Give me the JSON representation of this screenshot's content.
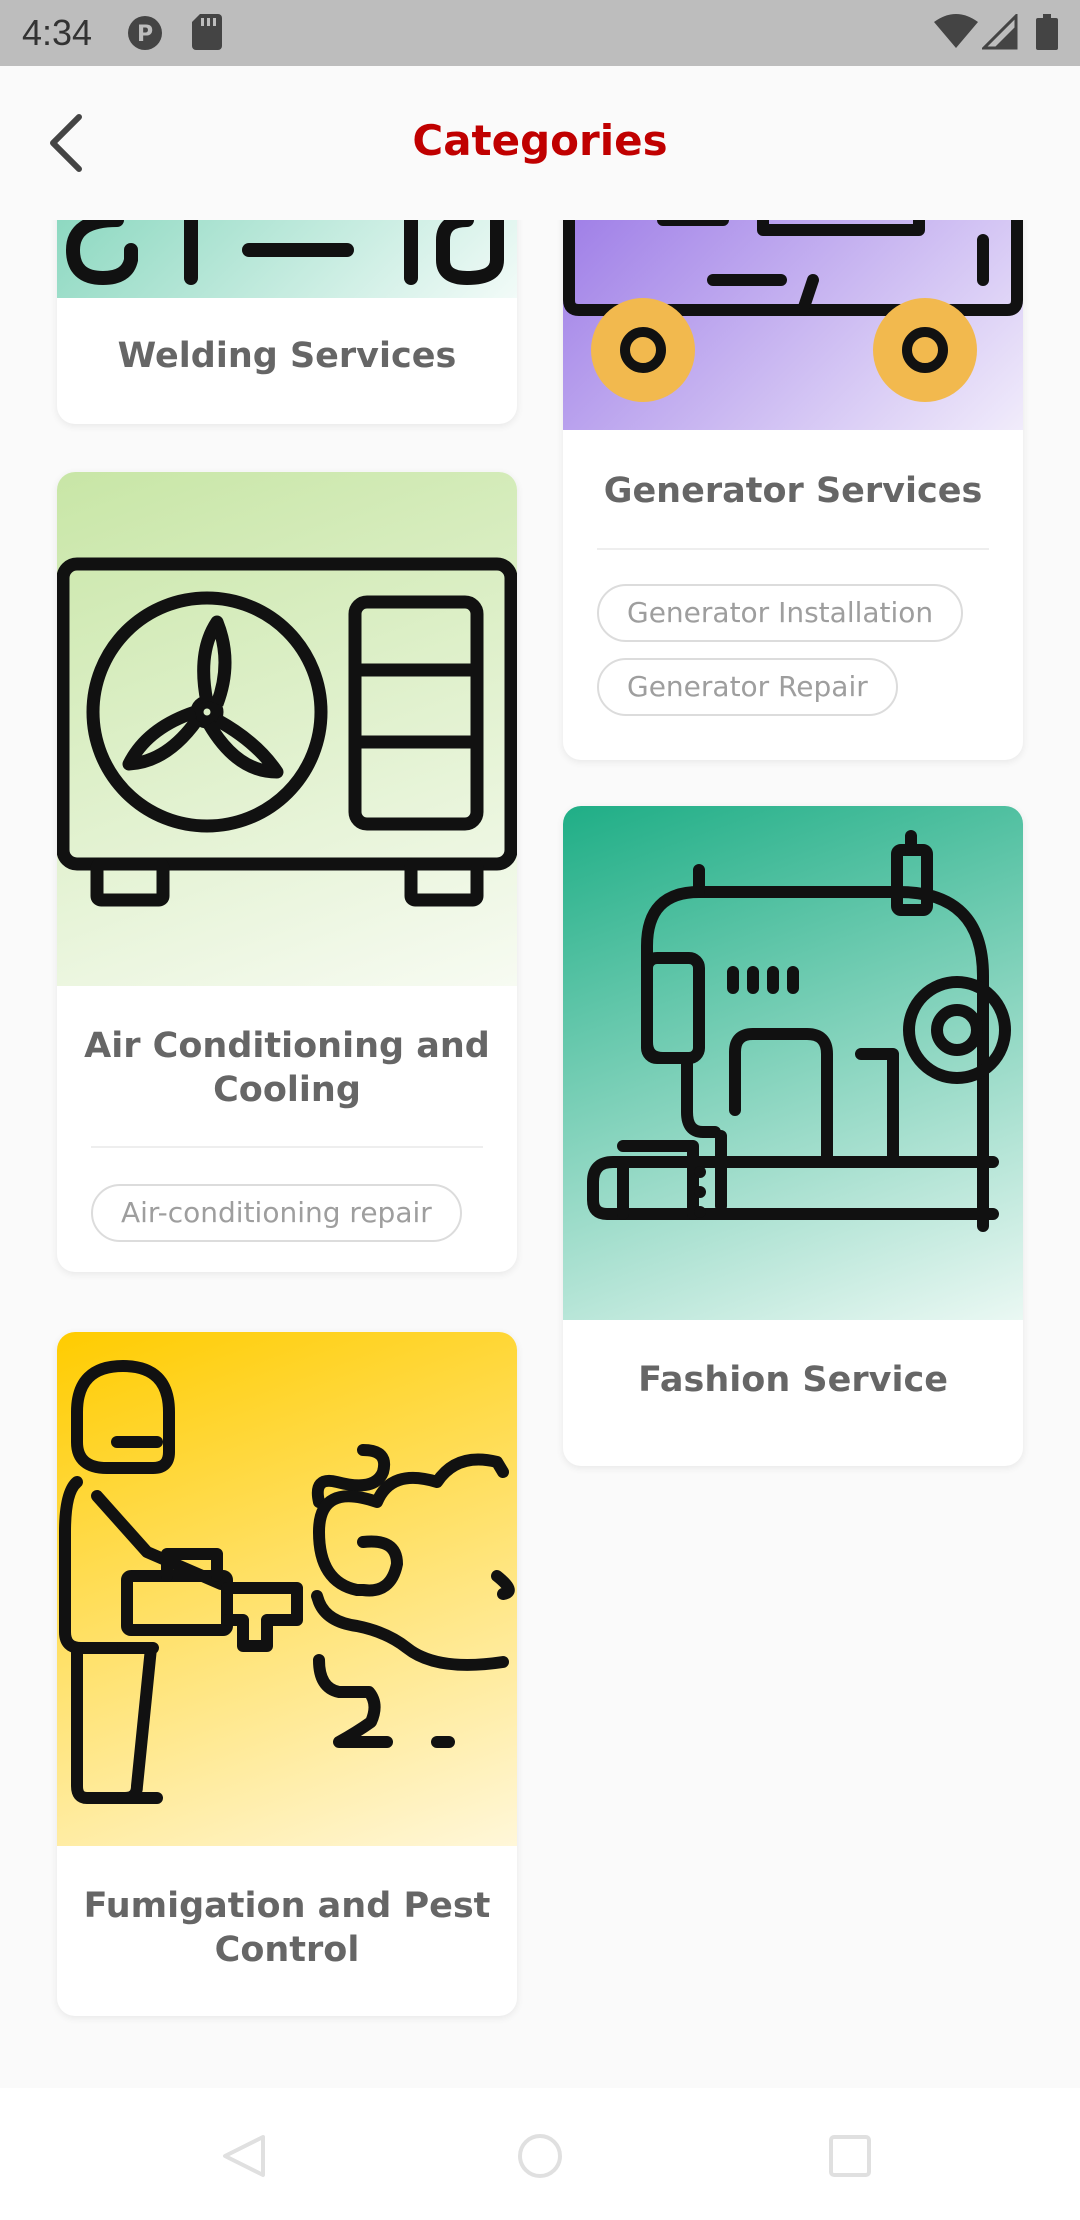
{
  "status_bar": {
    "time": "4:34",
    "icons": [
      "notification-p-icon",
      "sd-card-icon",
      "wifi-icon",
      "signal-icon",
      "battery-icon"
    ]
  },
  "app_bar": {
    "back_icon": "chevron-left-icon",
    "title": "Categories"
  },
  "colors": {
    "title": "#c00000",
    "card_text": "#666666",
    "chip_text": "#9e9e9e",
    "chip_border": "#dcdcdc"
  },
  "categories": {
    "welding": {
      "title": "Welding Services",
      "image_icon": "welding-icon",
      "image_gradient": [
        "#86d6bd",
        "#f2fbf8"
      ]
    },
    "generator": {
      "title": "Generator Services",
      "image_icon": "generator-icon",
      "image_gradient": [
        "#9a78e6",
        "#f1ecfb"
      ],
      "chips": [
        "Generator Installation",
        "Generator Repair"
      ]
    },
    "air_conditioning": {
      "title": "Air Conditioning and Cooling",
      "image_icon": "air-conditioner-icon",
      "image_gradient": [
        "#c8e6a6",
        "#f7fbf2"
      ],
      "chips": [
        "Air-conditioning repair"
      ]
    },
    "fashion": {
      "title": "Fashion Service",
      "image_icon": "sewing-machine-icon",
      "image_gradient": [
        "#1fae86",
        "#eaf8f3"
      ]
    },
    "fumigation": {
      "title": "Fumigation and Pest Control",
      "image_icon": "fumigation-icon",
      "image_gradient": [
        "#ffcc00",
        "#fff7d9"
      ]
    }
  },
  "nav_bar": {
    "back": "nav-back-icon",
    "home": "nav-home-icon",
    "recents": "nav-recents-icon"
  }
}
